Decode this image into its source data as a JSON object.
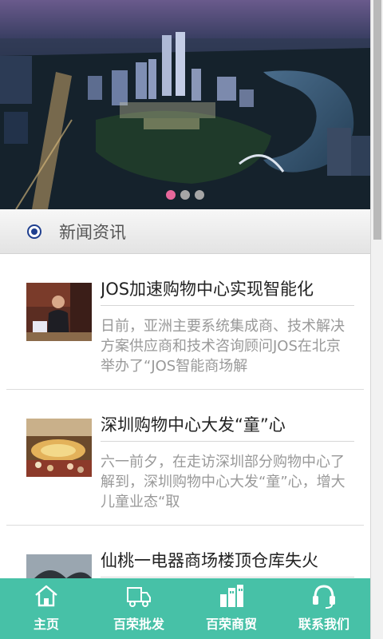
{
  "banner": {
    "alt": "city skyline night view",
    "slides": 3,
    "active_slide": 1,
    "colors": {
      "active_dot": "#e8679b",
      "dot": "#a6a6a6"
    }
  },
  "section": {
    "title": "新闻资讯"
  },
  "news": [
    {
      "title": "JOS加速购物中心实现智能化",
      "summary": "日前，亚洲主要系统集成商、技术解决方案供应商和技术咨询顾问JOS在北京举办了“JOS智能商场解",
      "thumb_icon": "presenter-photo"
    },
    {
      "title": "深圳购物中心大发“童”心",
      "summary": "六一前夕，在走访深圳部分购物中心了解到，深圳购物中心大发“童”心，增大儿童业态“取",
      "thumb_icon": "shopping-mall-photo"
    },
    {
      "title": "仙桃一电器商场楼顶仓库失火",
      "summary": "",
      "thumb_icon": "fire-photo"
    }
  ],
  "bottom_nav": {
    "colors": {
      "background": "#47c1a7",
      "text": "#ffffff"
    },
    "items": [
      {
        "label": "主页",
        "icon": "home-icon"
      },
      {
        "label": "百荣批发",
        "icon": "truck-icon"
      },
      {
        "label": "百荣商贸",
        "icon": "buildings-icon"
      },
      {
        "label": "联系我们",
        "icon": "headset-icon"
      }
    ]
  }
}
